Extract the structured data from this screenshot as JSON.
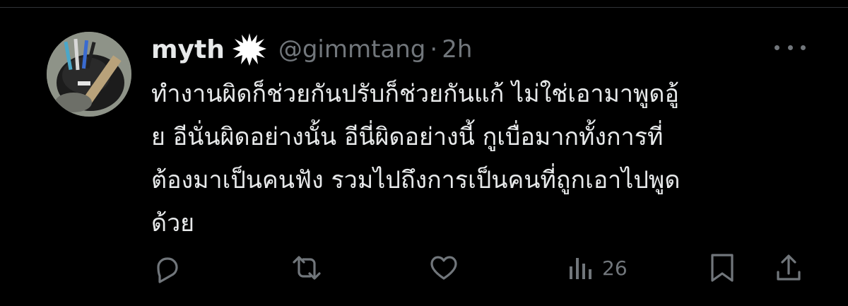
{
  "tweet": {
    "display_name": "myth",
    "handle": "@gimmtang",
    "separator": "·",
    "time": "2h",
    "text_lines": [
      "ทำงานผิดก็ช่วยกันปรับก็ช่วยกันแก้ ไม่ใช่เอามาพูดอู้",
      "ย อีนั่นผิดอย่างนั้น อีนี่ผิดอย่างนี้ กูเบื่อมากทั้งการที่",
      "ต้องมาเป็นคนฟัง รวมไปถึงการเป็นคนที่ถูกเอาไปพูด",
      "ด้วย"
    ],
    "views": "26"
  },
  "icons": {
    "badge": "sparkle-burst-icon",
    "more": "more-horizontal-icon",
    "reply": "reply-icon",
    "retweet": "retweet-icon",
    "like": "heart-icon",
    "views": "analytics-icon",
    "bookmark": "bookmark-icon",
    "share": "share-icon"
  },
  "colors": {
    "background": "#000000",
    "text_primary": "#e7e9ea",
    "text_secondary": "#71767b",
    "divider": "#2f3336"
  }
}
